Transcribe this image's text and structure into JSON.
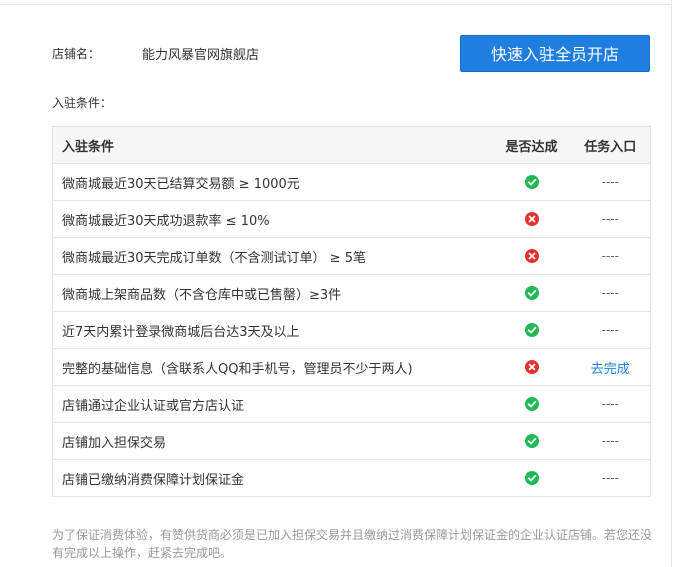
{
  "store": {
    "label": "店铺名：",
    "name": "能力风暴官网旗舰店",
    "cta": "快速入驻全员开店"
  },
  "conditions_title": "入驻条件：",
  "table": {
    "headers": [
      "入驻条件",
      "是否达成",
      "任务入口"
    ],
    "rows": [
      {
        "text": "微商城最近30天已结算交易额 ≥ 1000元",
        "status": "ok",
        "entry": "----"
      },
      {
        "text": "微商城最近30天成功退款率 ≤ 10%",
        "status": "no",
        "entry": "----"
      },
      {
        "text": "微商城最近30天完成订单数（不含测试订单） ≥ 5笔",
        "status": "no",
        "entry": "----"
      },
      {
        "text": "微商城上架商品数（不含仓库中或已售罄）≥3件",
        "status": "ok",
        "entry": "----"
      },
      {
        "text": "近7天内累计登录微商城后台达3天及以上",
        "status": "ok",
        "entry": "----"
      },
      {
        "text": "完整的基础信息（含联系人QQ和手机号，管理员不少于两人)",
        "status": "no",
        "entry": "去完成"
      },
      {
        "text": "店铺通过企业认证或官方店认证",
        "status": "ok",
        "entry": "----"
      },
      {
        "text": "店铺加入担保交易",
        "status": "ok",
        "entry": "----"
      },
      {
        "text": "店铺已缴纳消费保障计划保证金",
        "status": "ok",
        "entry": "----"
      }
    ]
  },
  "note": "为了保证消费体验，有赞供货商必须是已加入担保交易并且缴纳过消费保障计划保证金的企业认证店铺。若您还没有完成以上操作，赶紧去完成吧。",
  "icons": {
    "ok": "check-circle-icon",
    "no": "cross-circle-icon"
  },
  "colors": {
    "accent": "#1f7ee0",
    "ok": "#1fb955",
    "no": "#e23131"
  }
}
